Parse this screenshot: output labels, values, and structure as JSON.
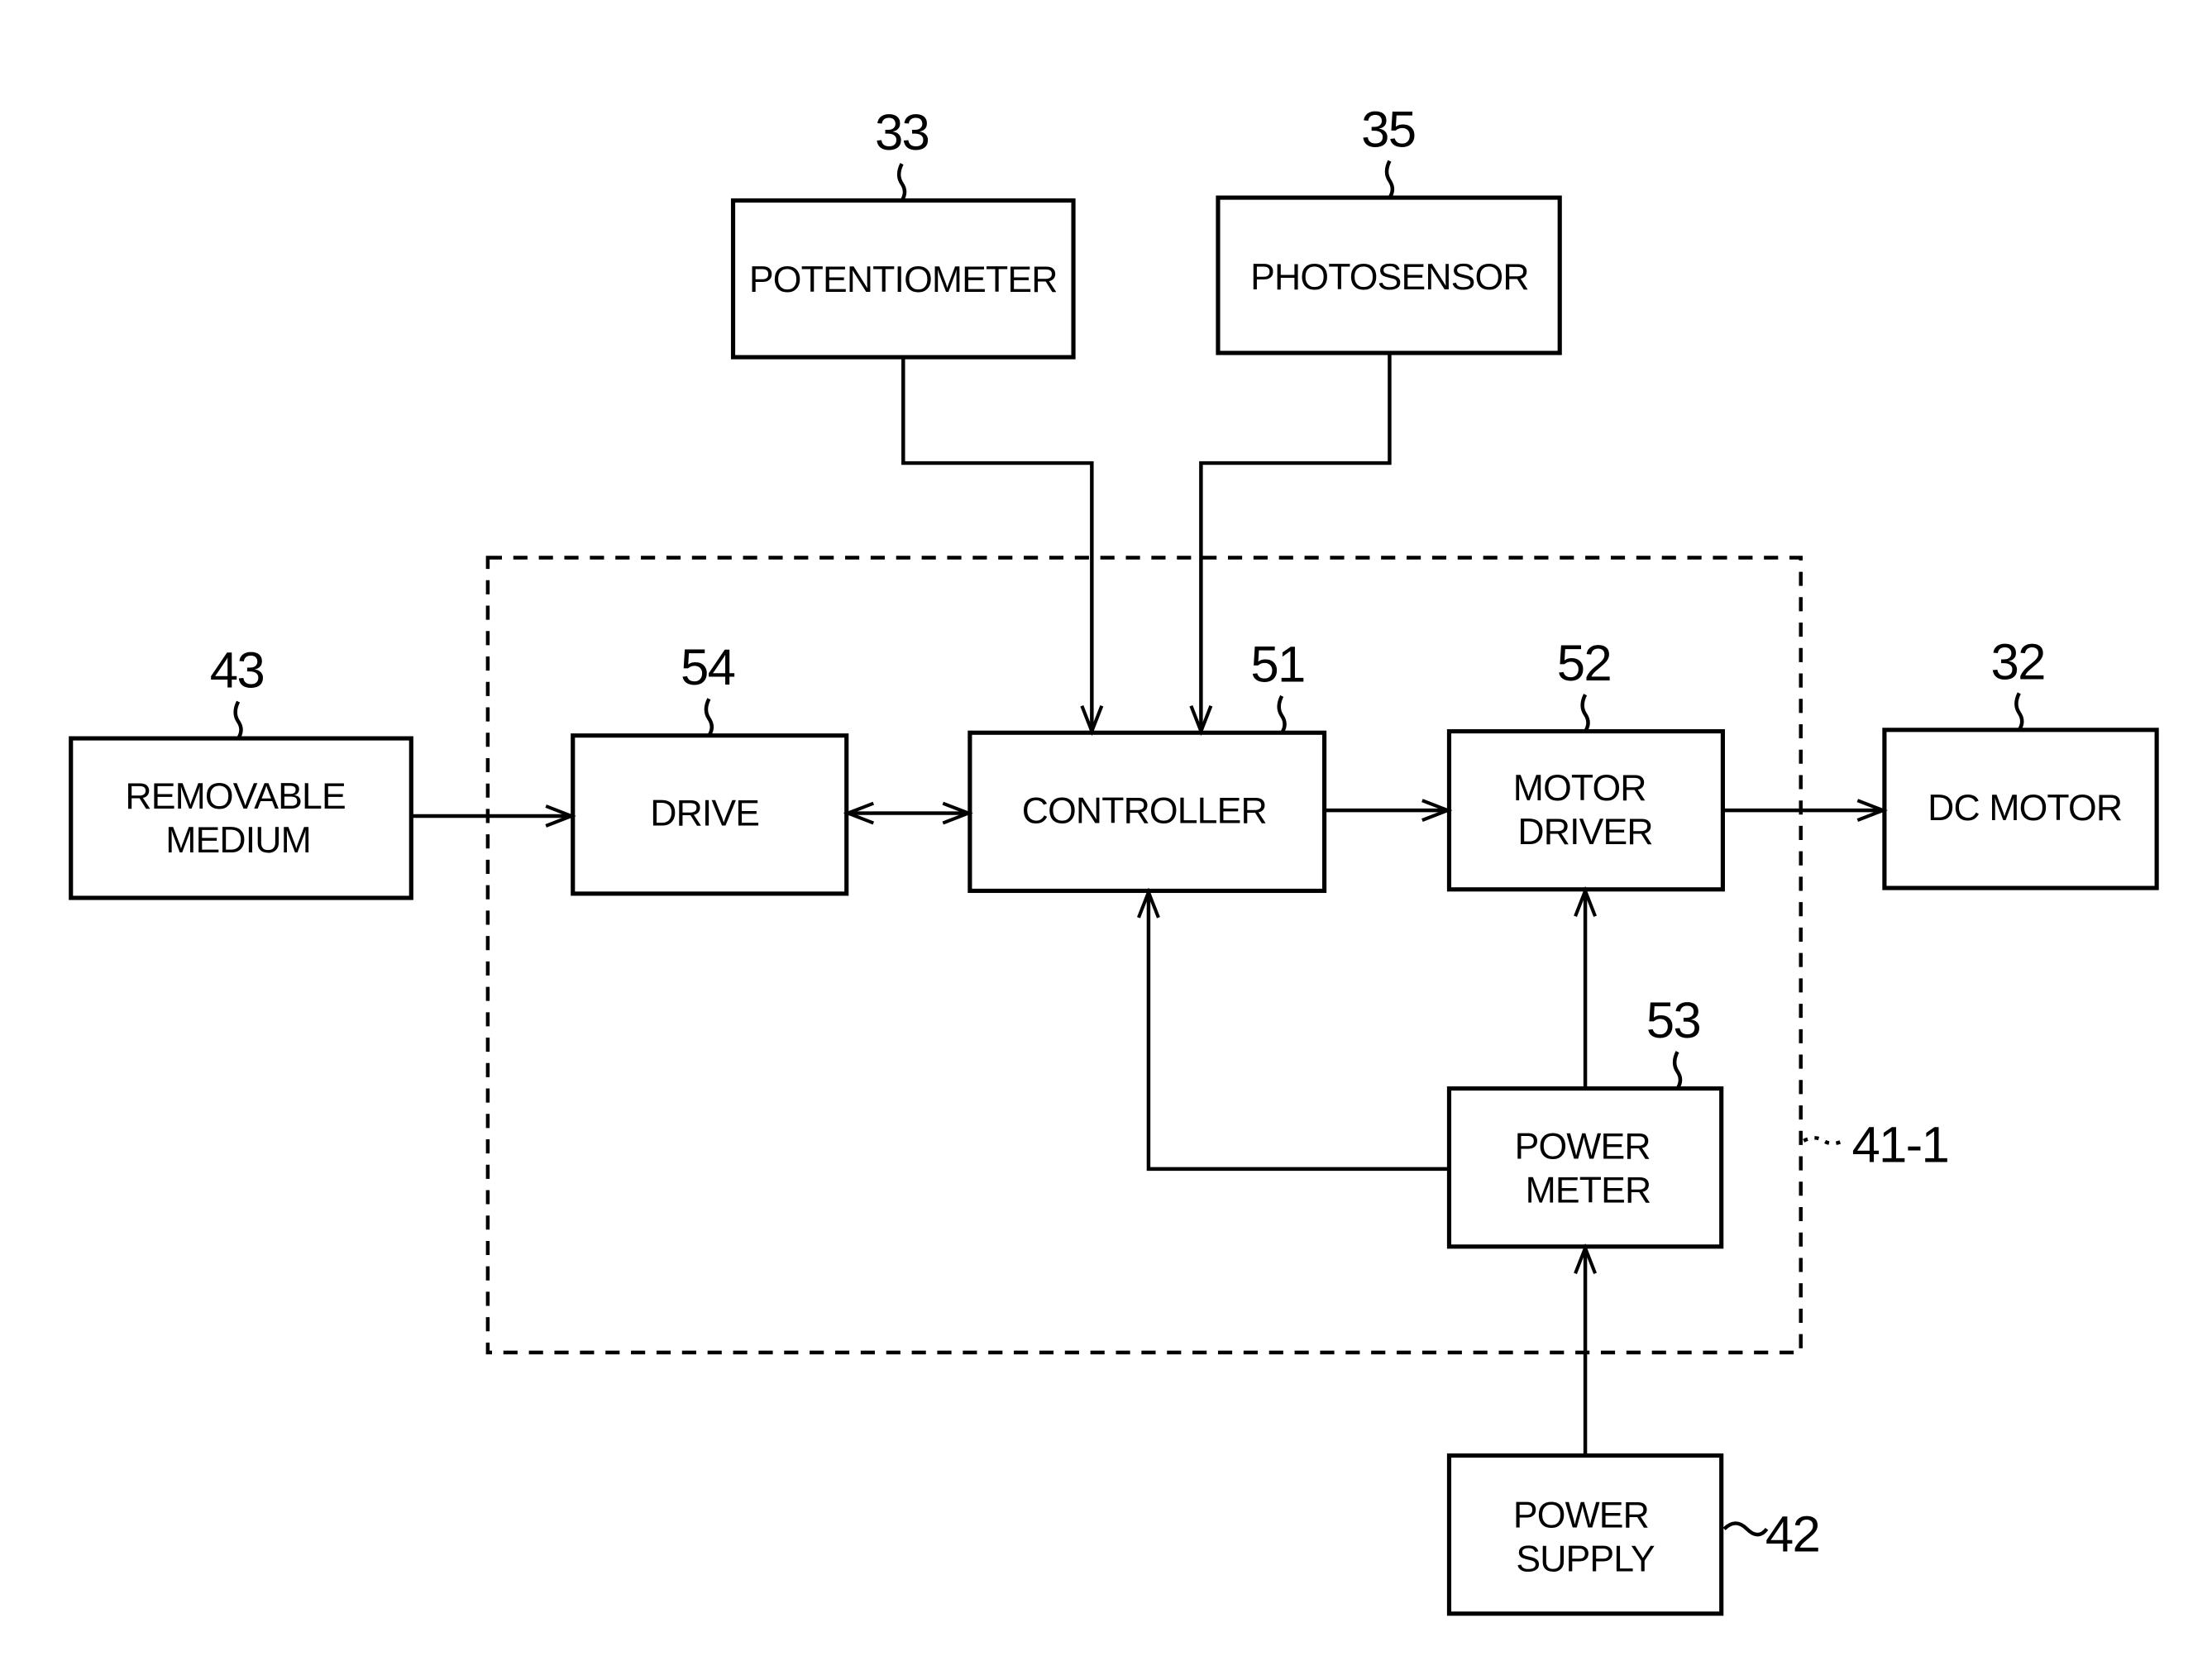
{
  "figure": {
    "blocks": {
      "potentiometer": {
        "label": [
          "POTENTIOMETER"
        ],
        "ref": "33"
      },
      "photosensor": {
        "label": [
          "PHOTOSENSOR"
        ],
        "ref": "35"
      },
      "removable_medium": {
        "label": [
          "REMOVABLE",
          "MEDIUM"
        ],
        "ref": "43"
      },
      "drive": {
        "label": [
          "DRIVE"
        ],
        "ref": "54"
      },
      "controller": {
        "label": [
          "CONTROLLER"
        ],
        "ref": "51"
      },
      "motor_driver": {
        "label": [
          "MOTOR",
          "DRIVER"
        ],
        "ref": "52"
      },
      "dc_motor": {
        "label": [
          "DC MOTOR"
        ],
        "ref": "32"
      },
      "power_meter": {
        "label": [
          "POWER",
          "METER"
        ],
        "ref": "53"
      },
      "power_supply": {
        "label": [
          "POWER",
          "SUPPLY"
        ],
        "ref": "42"
      }
    },
    "group": {
      "ref": "41-1"
    },
    "connections": [
      {
        "from": "potentiometer",
        "to": "controller",
        "type": "arrow"
      },
      {
        "from": "photosensor",
        "to": "controller",
        "type": "arrow"
      },
      {
        "from": "removable_medium",
        "to": "drive",
        "type": "arrow"
      },
      {
        "from": "drive",
        "to": "controller",
        "type": "bidirectional"
      },
      {
        "from": "controller",
        "to": "motor_driver",
        "type": "arrow"
      },
      {
        "from": "motor_driver",
        "to": "dc_motor",
        "type": "arrow"
      },
      {
        "from": "power_meter",
        "to": "motor_driver",
        "type": "arrow"
      },
      {
        "from": "power_meter",
        "to": "controller",
        "type": "arrow"
      },
      {
        "from": "power_supply",
        "to": "power_meter",
        "type": "arrow"
      }
    ]
  }
}
